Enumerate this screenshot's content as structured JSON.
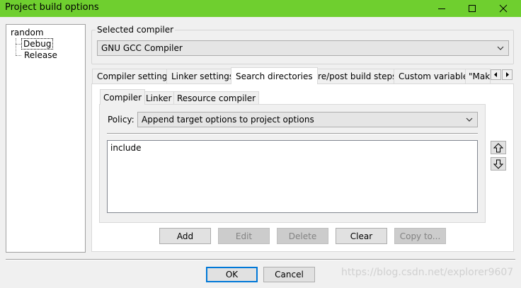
{
  "window": {
    "title": "Project build options",
    "title_color": "#6fcf2f"
  },
  "tree": {
    "root": "random",
    "children": [
      "Debug",
      "Release"
    ],
    "selected": "Debug"
  },
  "selected_compiler": {
    "label": "Selected compiler",
    "value": "GNU GCC Compiler"
  },
  "tabs": [
    "Compiler settings",
    "Linker settings",
    "Search directories",
    "Pre/post build steps",
    "Custom variables",
    "\"Make"
  ],
  "active_tab": "Search directories",
  "inner_tabs": [
    "Compiler",
    "Linker",
    "Resource compiler"
  ],
  "active_inner_tab": "Compiler",
  "policy": {
    "label": "Policy:",
    "value": "Append target options to project options"
  },
  "directories": [
    "include"
  ],
  "buttons": {
    "add": "Add",
    "edit": "Edit",
    "delete": "Delete",
    "clear": "Clear",
    "copy_to": "Copy to..."
  },
  "dialog_buttons": {
    "ok": "OK",
    "cancel": "Cancel"
  },
  "watermark": "https://blog.csdn.net/explorer9607"
}
